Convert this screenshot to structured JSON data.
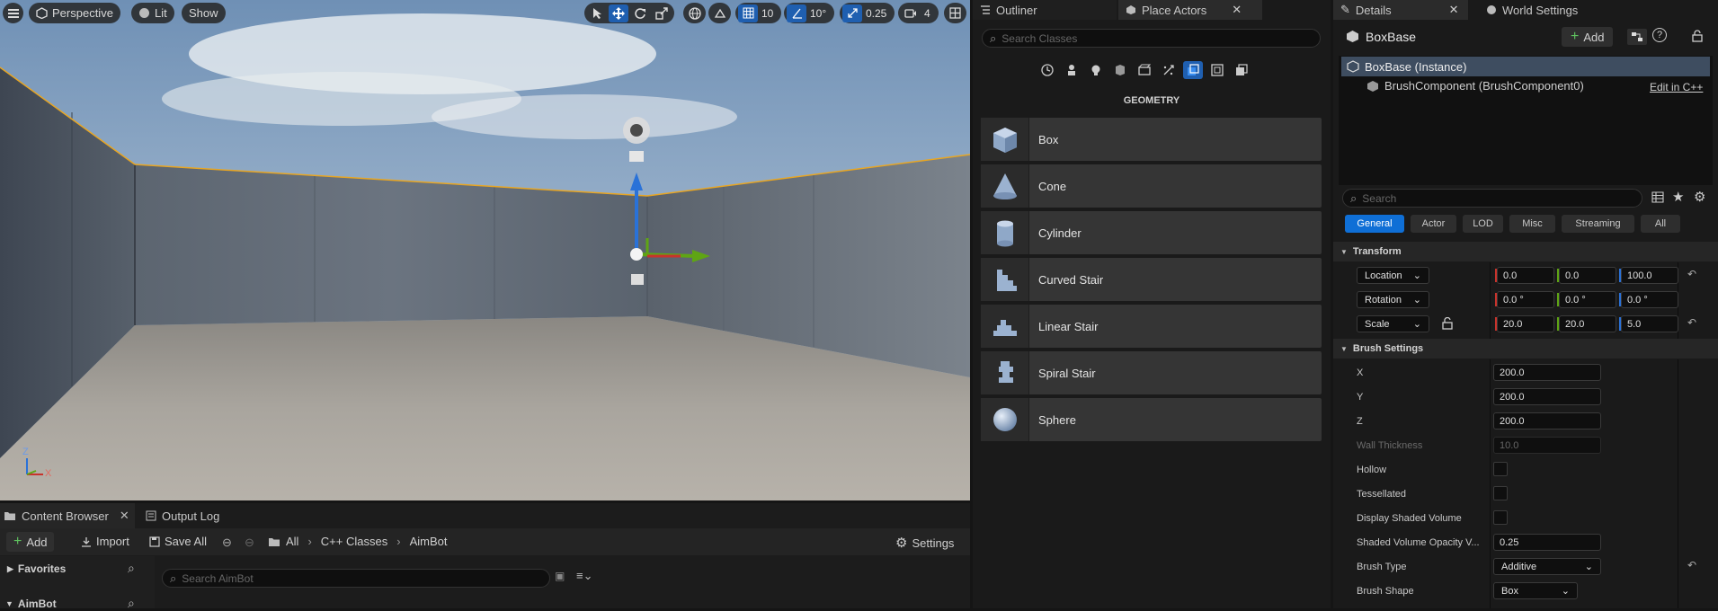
{
  "viewport": {
    "menu_icon": "hamburger-icon",
    "perspective_label": "Perspective",
    "lit_label": "Lit",
    "show_label": "Show",
    "grid_snap_value": "10",
    "rotation_snap_value": "10°",
    "scale_snap_value": "0.25",
    "camera_speed_value": "4",
    "axis_labels": {
      "z": "Z",
      "x": "X"
    }
  },
  "bottom_panel": {
    "tabs": [
      {
        "label": "Content Browser"
      },
      {
        "label": "Output Log"
      }
    ],
    "toolbar": {
      "add_label": "Add",
      "import_label": "Import",
      "save_all_label": "Save All",
      "breadcrumbs": [
        "All",
        "C++ Classes",
        "AimBot"
      ],
      "settings_label": "Settings"
    },
    "sources": {
      "favorites_label": "Favorites",
      "project_label": "AimBot"
    },
    "search": {
      "placeholder": "Search AimBot"
    }
  },
  "place_actors": {
    "tabs": [
      {
        "label": "Outliner"
      },
      {
        "label": "Place Actors"
      }
    ],
    "search": {
      "placeholder": "Search Classes"
    },
    "category_title": "GEOMETRY",
    "category_icons": [
      "recent-icon",
      "basic-icon",
      "lights-icon",
      "shapes-icon",
      "cinematic-icon",
      "visual-effects-icon",
      "geometry-icon",
      "volumes-icon",
      "all-classes-icon"
    ],
    "items": [
      {
        "label": "Box",
        "icon": "box-icon"
      },
      {
        "label": "Cone",
        "icon": "cone-icon"
      },
      {
        "label": "Cylinder",
        "icon": "cylinder-icon"
      },
      {
        "label": "Curved Stair",
        "icon": "curved-stair-icon"
      },
      {
        "label": "Linear Stair",
        "icon": "linear-stair-icon"
      },
      {
        "label": "Spiral Stair",
        "icon": "spiral-stair-icon"
      },
      {
        "label": "Sphere",
        "icon": "sphere-icon"
      }
    ]
  },
  "details": {
    "tabs": [
      {
        "label": "Details"
      },
      {
        "label": "World Settings"
      }
    ],
    "actor_name": "BoxBase",
    "add_label": "Add",
    "tree": {
      "instance_label": "BoxBase (Instance)",
      "component_label": "BrushComponent (BrushComponent0)",
      "edit_link": "Edit in C++"
    },
    "search": {
      "placeholder": "Search"
    },
    "filters": [
      "General",
      "Actor",
      "LOD",
      "Misc",
      "Streaming",
      "All"
    ],
    "transform": {
      "header": "Transform",
      "location": {
        "label": "Location",
        "x": "0.0",
        "y": "0.0",
        "z": "100.0"
      },
      "rotation": {
        "label": "Rotation",
        "x": "0.0 °",
        "y": "0.0 °",
        "z": "0.0 °"
      },
      "scale": {
        "label": "Scale",
        "x": "20.0",
        "y": "20.0",
        "z": "5.0"
      }
    },
    "brush_settings": {
      "header": "Brush Settings",
      "x": {
        "label": "X",
        "value": "200.0"
      },
      "y": {
        "label": "Y",
        "value": "200.0"
      },
      "z": {
        "label": "Z",
        "value": "200.0"
      },
      "wall_thickness": {
        "label": "Wall Thickness",
        "value": "10.0"
      },
      "hollow": {
        "label": "Hollow",
        "checked": false
      },
      "tessellated": {
        "label": "Tessellated",
        "checked": false
      },
      "display_shaded_volume": {
        "label": "Display Shaded Volume",
        "checked": false
      },
      "shaded_volume_opacity": {
        "label": "Shaded Volume Opacity V...",
        "value": "0.25"
      },
      "brush_type": {
        "label": "Brush Type",
        "value": "Additive"
      },
      "brush_shape": {
        "label": "Brush Shape",
        "value": "Box"
      }
    }
  },
  "colors": {
    "accent": "#0f6fd6",
    "axis_x": "#c8332c",
    "axis_y": "#5fa514",
    "axis_z": "#2a72d8",
    "selection_outline": "#e8a623"
  }
}
